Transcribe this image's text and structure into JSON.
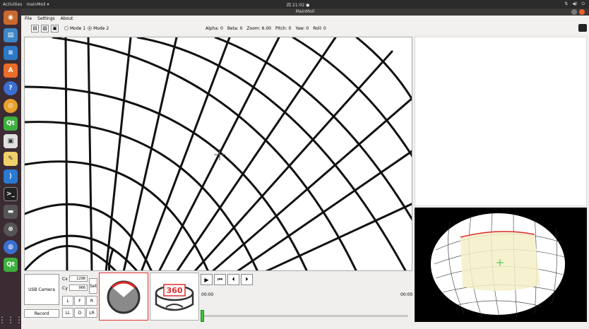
{
  "system": {
    "activities": "Activities",
    "app_menu": "mainMoil ▾",
    "clock": "四 21:02 ●"
  },
  "window": {
    "title": "MainMoil"
  },
  "menu": {
    "items": [
      "File",
      "Settings",
      "About"
    ]
  },
  "toolbar": {
    "modes": [
      "Mode 1",
      "Mode 2"
    ],
    "selected_mode": "Mode 2",
    "stats": [
      "Alpha: 0",
      "Beta: 0",
      "Zoom: 6.00",
      "Pitch: 0",
      "Yaw: 0",
      "Roll: 0"
    ]
  },
  "controls": {
    "camera_button": "USB Camera",
    "record_button": "Record",
    "cx_label": "Cx",
    "cx_value": "1298",
    "cy_label": "Cy",
    "cy_value": "966",
    "set_button": "Set",
    "view_buttons": [
      "L",
      "F",
      "R",
      "LL",
      "D",
      "LR"
    ],
    "time_start": "00:00",
    "time_end": "00:00",
    "slider_position": 0.0,
    "icon360_label": "360"
  },
  "colors": {
    "accent_red": "#dd2b2b",
    "slider_green": "#3cc13c",
    "highlight_region": "#f5f0c8"
  }
}
